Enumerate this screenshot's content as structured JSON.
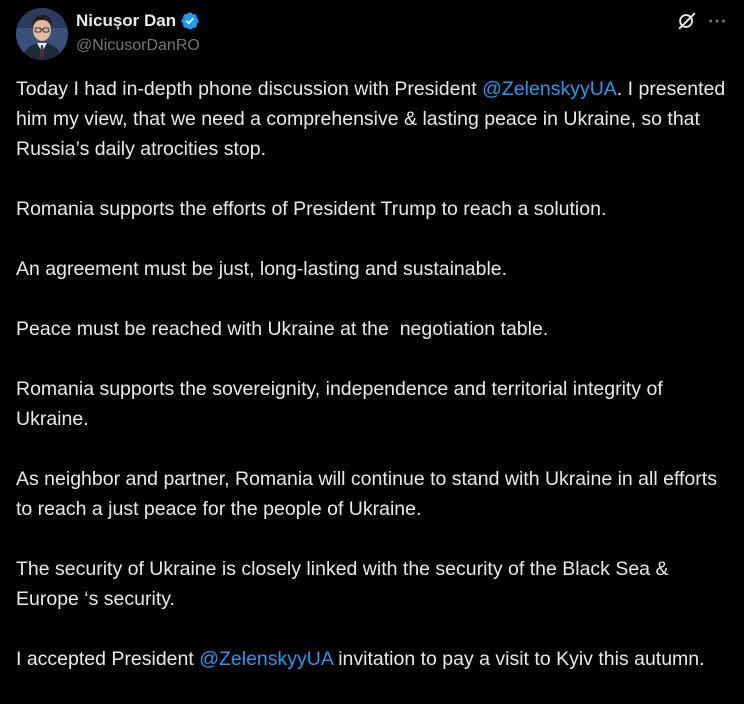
{
  "author": {
    "display_name": "Nicușor Dan",
    "handle": "@NicusorDanRO",
    "verified": true
  },
  "colors": {
    "background": "#000000",
    "text": "#e7e9ea",
    "secondary_text": "#71767b",
    "accent": "#1d9bf0"
  },
  "icons": {
    "verified": "verified-badge-icon",
    "grok": "grok-icon",
    "more": "more-options-icon"
  },
  "tweet": {
    "p1": {
      "before": "Today I had in-depth phone discussion with President ",
      "mention": "@ZelenskyyUA",
      "after": ". I presented him my view, that we need a comprehensive & lasting peace in Ukraine, so that Russia’s daily atrocities stop."
    },
    "p2": "Romania supports the efforts of President Trump to reach a solution.",
    "p3": "An agreement must be just, long-lasting and sustainable.",
    "p4": "Peace must be reached with Ukraine at the  negotiation table.",
    "p5": "Romania supports the sovereignity, independence and territorial integrity of Ukraine.",
    "p6": "As neighbor and partner, Romania will continue to stand with Ukraine in all efforts to reach a just peace for the people of Ukraine.",
    "p7": "The security of Ukraine is closely linked with the security of the Black Sea & Europe ‘s security.",
    "p8": {
      "before": "I accepted President ",
      "mention": "@ZelenskyyUA",
      "after": " invitation to pay a visit to Kyiv this autumn."
    }
  }
}
